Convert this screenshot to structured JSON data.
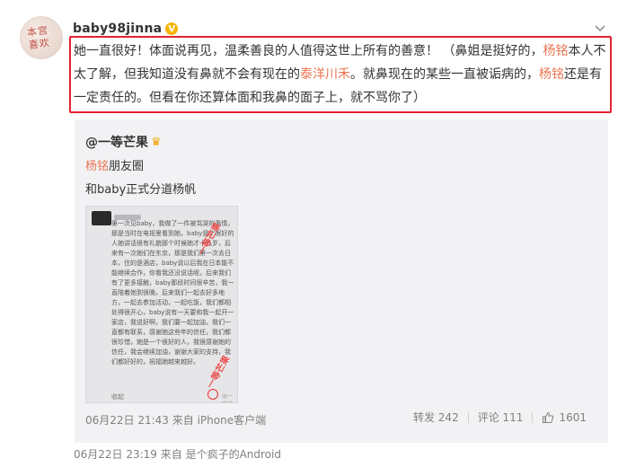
{
  "post": {
    "avatar_text": "本宫喜欢",
    "username": "baby98jinna",
    "verified_mark": "V",
    "text_parts": [
      {
        "text": "她一直很好！体面说再见，温柔善良的人值得这世上所有的善意！ （鼻姐是挺好的，",
        "link": false
      },
      {
        "text": "杨铭",
        "link": true
      },
      {
        "text": "本人不太了解，但我知道没有鼻就不会有现在的",
        "link": false
      },
      {
        "text": "泰洋川禾",
        "link": true
      },
      {
        "text": "。就鼻现在的某些一直被诟病的，",
        "link": false
      },
      {
        "text": "杨铭",
        "link": true
      },
      {
        "text": "还是有一定责任的。但看在你还算体面和我鼻的面子上，就不骂你了）",
        "link": false
      }
    ],
    "time_source": "06月22日 23:19  来自 是个疯子的Android"
  },
  "repost": {
    "author": "@一等芒果",
    "line1_link": "杨铭",
    "line1_rest": "朋友圈",
    "line2": "和baby正式分道杨帆",
    "image": {
      "text": "第一次见baby，我做了一件被骂哭的事情，那是当时在电视里看到她，baby是个很好的人她讲话很有礼貌那个时候她才十几岁，后来有一次她们在东京，那是我们第一次去日本，住的是酒店，baby说以后我在日本能不能继续合作，你看我还没说话呢，后来我们有了更多接触，baby那段时间很辛苦，我一直陪着她到很晚，后来我们一起去好多地方，一起去参加活动，一起吃饭，我们都相处得很开心，baby说有一天要和我一起开一家店，我说好啊，我们要一起加油，我们一直都有联系，感谢她这些年的信任，我们都很珍惜，她是一个很好的人，我很感谢她的信任，我会继续加油，谢谢大家的支持，我们都好好的，祝福她越来越好。",
      "footer": "收起",
      "watermark": "一等芒果",
      "tag": "@一等芒果"
    },
    "time_source": "06月22日 21:43  来自 iPhone客户端",
    "repost_count": "转发 242",
    "comment_count": "评论 111",
    "like_count": "1601"
  },
  "colors": {
    "link": "#eb7350",
    "highlight_border": "#e0232f",
    "verified": "#f7b500"
  }
}
